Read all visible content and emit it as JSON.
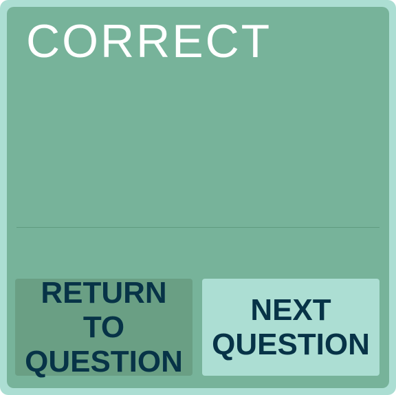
{
  "result": {
    "title": "CORRECT"
  },
  "buttons": {
    "return_line1": "RETURN TO",
    "return_line2": "QUESTION",
    "next_line1": "NEXT",
    "next_line2": "QUESTION"
  },
  "colors": {
    "outer_border": "#acded3",
    "panel": "#77b39a",
    "return_button": "#6a9f84",
    "next_button": "#acded3",
    "button_text": "#073347",
    "title_text": "#ffffff"
  }
}
